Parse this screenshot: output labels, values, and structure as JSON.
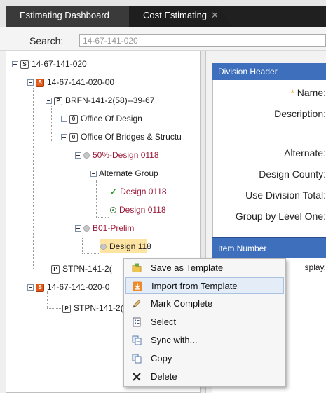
{
  "tabs": [
    {
      "label": "Estimating Dashboard"
    },
    {
      "label": "Cost Estimating",
      "close": "✕"
    }
  ],
  "search": {
    "label": "Search:",
    "value": "14-67-141-020"
  },
  "tree": {
    "root": "14-67-141-020",
    "node1": "14-67-141-020-00",
    "node2": "BRFN-141-2(58)--39-67",
    "node3": "Office Of Design",
    "node4": "Office Of Bridges & Structu",
    "node5": "50%-Design 0118",
    "node6": "Alternate Group",
    "node7": "Design 0118",
    "node8": "Design 0118",
    "node9": "B01-Prelim",
    "node10": "Design 118",
    "node11": "STPN-141-2(",
    "node12": "14-67-141-020-0",
    "node13": "STPN-141-2("
  },
  "division": {
    "header": "Division Header",
    "required_mark": "*",
    "name": "Name:",
    "description": "Description:",
    "alternate": "Alternate:",
    "design_county": "Design County:",
    "use_division_total": "Use Division Total:",
    "group_by_level_one": "Group by Level One:"
  },
  "grid": {
    "column": "Item Number",
    "empty_text": "splay."
  },
  "context_menu": {
    "items": [
      {
        "label": "Save as Template",
        "icon": "folder-icon"
      },
      {
        "label": "Import from Template",
        "icon": "import-icon"
      },
      {
        "label": "Mark Complete",
        "icon": "pencil-icon"
      },
      {
        "label": "Select",
        "icon": "select-doc-icon"
      },
      {
        "label": "Sync with...",
        "icon": "sync-icon"
      },
      {
        "label": "Copy",
        "icon": "copy-icon"
      },
      {
        "label": "Delete",
        "icon": "delete-x-icon"
      }
    ],
    "hovered_index": 1
  }
}
